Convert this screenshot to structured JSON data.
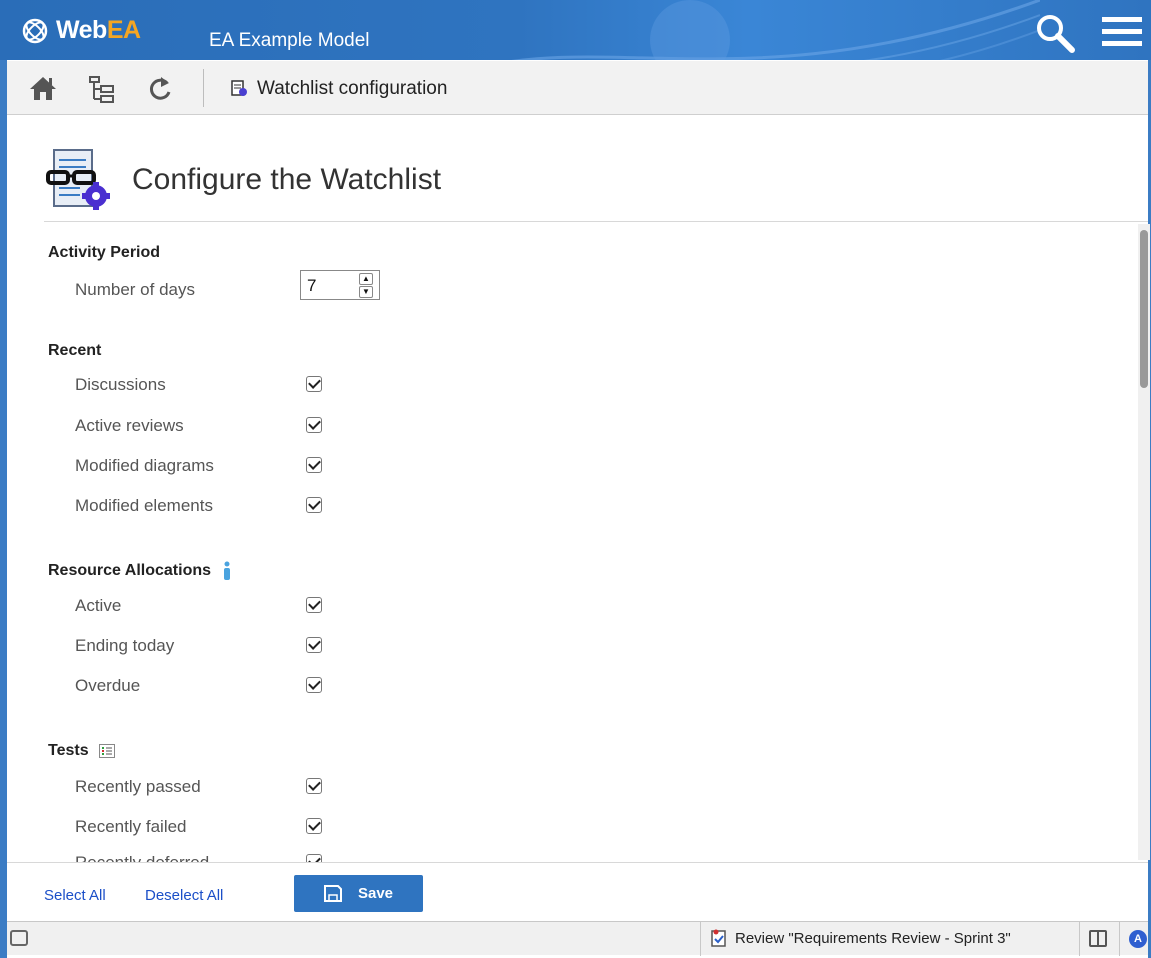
{
  "app": {
    "logo_prefix": "Web",
    "logo_suffix": "EA",
    "model_title": "EA Example Model"
  },
  "toolbar": {
    "breadcrumb": "Watchlist configuration",
    "icons": [
      "home-icon",
      "model-tree-icon",
      "refresh-icon",
      "watchlist-icon"
    ]
  },
  "page": {
    "title": "Configure the Watchlist"
  },
  "sections": {
    "activity": {
      "title": "Activity Period",
      "days_label": "Number of days",
      "days_value": "7"
    },
    "recent": {
      "title": "Recent",
      "items": [
        {
          "label": "Discussions",
          "checked": true
        },
        {
          "label": "Active reviews",
          "checked": true
        },
        {
          "label": "Modified diagrams",
          "checked": true
        },
        {
          "label": "Modified elements",
          "checked": true
        }
      ]
    },
    "resources": {
      "title": "Resource Allocations",
      "items": [
        {
          "label": "Active",
          "checked": true
        },
        {
          "label": "Ending today",
          "checked": true
        },
        {
          "label": "Overdue",
          "checked": true
        }
      ]
    },
    "tests": {
      "title": "Tests",
      "items": [
        {
          "label": "Recently passed",
          "checked": true
        },
        {
          "label": "Recently failed",
          "checked": true
        },
        {
          "label": "Recently deferred",
          "checked": true
        }
      ]
    }
  },
  "footer": {
    "select_all": "Select All",
    "deselect_all": "Deselect All",
    "save": "Save"
  },
  "status": {
    "review": "Review \"Requirements Review - Sprint 3\"",
    "badge": "A"
  },
  "colors": {
    "brand_blue": "#2f74c0",
    "logo_accent": "#f5a623",
    "link": "#1b4fc8"
  }
}
